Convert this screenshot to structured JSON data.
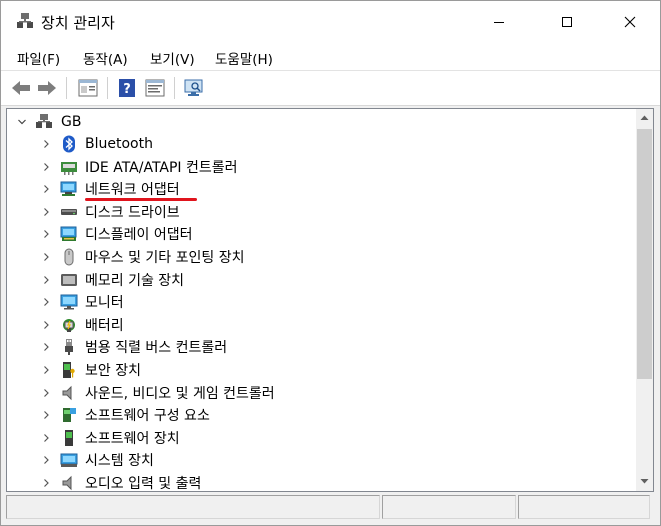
{
  "window": {
    "title": "장치 관리자"
  },
  "menu": {
    "file": "파일(F)",
    "action": "동작(A)",
    "view": "보기(V)",
    "help": "도움말(H)"
  },
  "tree": {
    "root": "GB",
    "items": [
      {
        "label": "Bluetooth",
        "icon": "bluetooth-icon"
      },
      {
        "label": "IDE ATA/ATAPI 컨트롤러",
        "icon": "ide-controller-icon"
      },
      {
        "label": "네트워크 어댑터",
        "icon": "network-adapter-icon",
        "highlighted": true
      },
      {
        "label": "디스크 드라이브",
        "icon": "disk-drive-icon"
      },
      {
        "label": "디스플레이 어댑터",
        "icon": "display-adapter-icon"
      },
      {
        "label": "마우스 및 기타 포인팅 장치",
        "icon": "mouse-icon"
      },
      {
        "label": "메모리 기술 장치",
        "icon": "memory-device-icon"
      },
      {
        "label": "모니터",
        "icon": "monitor-icon"
      },
      {
        "label": "배터리",
        "icon": "battery-icon"
      },
      {
        "label": "범용 직렬 버스 컨트롤러",
        "icon": "usb-icon"
      },
      {
        "label": "보안 장치",
        "icon": "security-device-icon"
      },
      {
        "label": "사운드, 비디오 및 게임 컨트롤러",
        "icon": "sound-icon"
      },
      {
        "label": "소프트웨어 구성 요소",
        "icon": "software-component-icon"
      },
      {
        "label": "소프트웨어 장치",
        "icon": "software-device-icon"
      },
      {
        "label": "시스템 장치",
        "icon": "system-device-icon"
      },
      {
        "label": "오디오 입력 및 출력",
        "icon": "audio-io-icon"
      }
    ]
  },
  "colors": {
    "highlight_underline": "#e0141d",
    "selection_accent": "#0078d7"
  }
}
